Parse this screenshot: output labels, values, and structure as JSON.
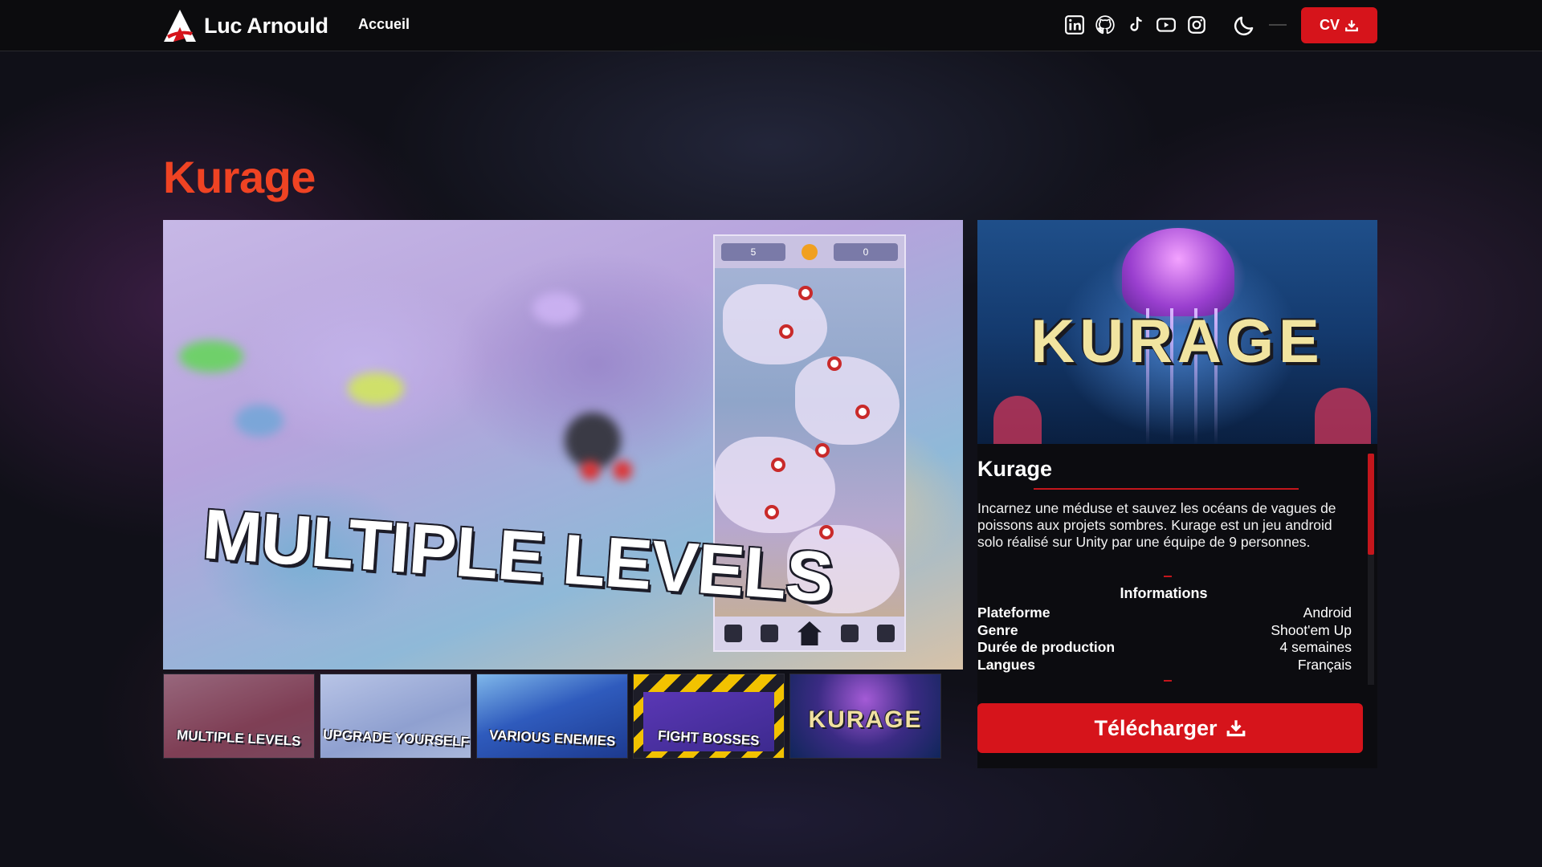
{
  "navbar": {
    "brand_name": "Luc Arnould",
    "links": [
      "Accueil"
    ],
    "social_icons": [
      "linkedin-icon",
      "github-icon",
      "tiktok-icon",
      "youtube-icon",
      "instagram-icon"
    ],
    "theme_toggle_icon": "moon-icon",
    "cv_label": "CV",
    "accent_color": "#d6141b"
  },
  "page": {
    "title": "Kurage",
    "title_color": "#ef4323"
  },
  "showcase": {
    "headline": "MULTIPLE LEVELS",
    "phone": {
      "left_score": "5",
      "right_score": "0"
    }
  },
  "thumbnails": [
    {
      "label": "MULTIPLE LEVELS",
      "selected": true
    },
    {
      "label": "UPGRADE YOURSELF",
      "selected": false
    },
    {
      "label": "VARIOUS ENEMIES",
      "selected": false
    },
    {
      "label": "FIGHT BOSSES",
      "selected": false
    },
    {
      "label": "KURAGE",
      "selected": false
    }
  ],
  "side_panel": {
    "cover_title": "KURAGE",
    "game_name": "Kurage",
    "description": "Incarnez une méduse et sauvez les océans de vagues de poissons aux projets sombres. Kurage est un jeu android solo réalisé sur Unity par une équipe de 9 personnes.",
    "info_heading": "Informations",
    "info": [
      {
        "key": "Plateforme",
        "value": "Android"
      },
      {
        "key": "Genre",
        "value": "Shoot'em Up"
      },
      {
        "key": "Durée de production",
        "value": "4 semaines"
      },
      {
        "key": "Langues",
        "value": "Français"
      }
    ],
    "download_label": "Télécharger"
  }
}
